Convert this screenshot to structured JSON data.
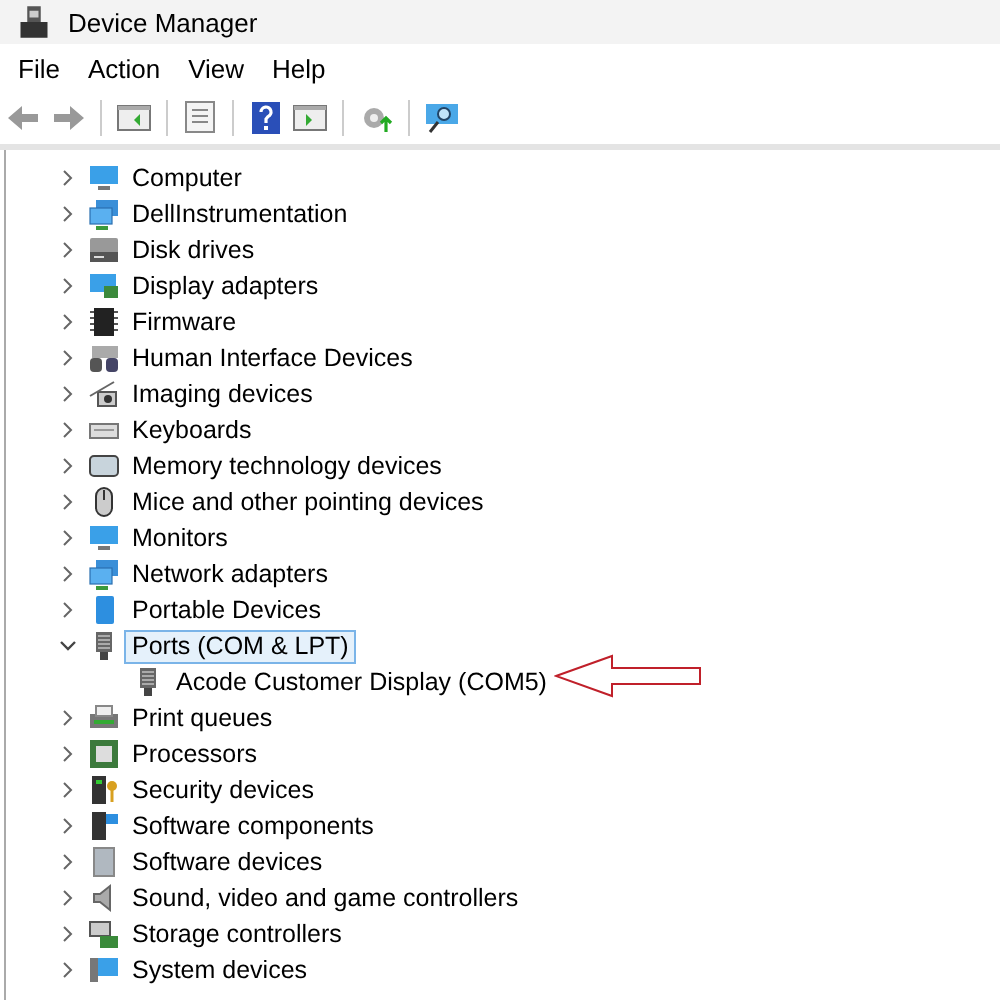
{
  "window": {
    "title": "Device Manager"
  },
  "menu": [
    "File",
    "Action",
    "View",
    "Help"
  ],
  "tree": [
    {
      "label": "Computer",
      "expanded": false,
      "selected": false
    },
    {
      "label": "DellInstrumentation",
      "expanded": false,
      "selected": false
    },
    {
      "label": "Disk drives",
      "expanded": false,
      "selected": false
    },
    {
      "label": "Display adapters",
      "expanded": false,
      "selected": false
    },
    {
      "label": "Firmware",
      "expanded": false,
      "selected": false
    },
    {
      "label": "Human Interface Devices",
      "expanded": false,
      "selected": false
    },
    {
      "label": "Imaging devices",
      "expanded": false,
      "selected": false
    },
    {
      "label": "Keyboards",
      "expanded": false,
      "selected": false
    },
    {
      "label": "Memory technology devices",
      "expanded": false,
      "selected": false
    },
    {
      "label": "Mice and other pointing devices",
      "expanded": false,
      "selected": false
    },
    {
      "label": "Monitors",
      "expanded": false,
      "selected": false
    },
    {
      "label": "Network adapters",
      "expanded": false,
      "selected": false
    },
    {
      "label": "Portable Devices",
      "expanded": false,
      "selected": false
    },
    {
      "label": "Ports (COM & LPT)",
      "expanded": true,
      "selected": true,
      "children": [
        {
          "label": "Acode Customer Display (COM5)",
          "selected": false
        }
      ]
    },
    {
      "label": "Print queues",
      "expanded": false,
      "selected": false
    },
    {
      "label": "Processors",
      "expanded": false,
      "selected": false
    },
    {
      "label": "Security devices",
      "expanded": false,
      "selected": false
    },
    {
      "label": "Software components",
      "expanded": false,
      "selected": false
    },
    {
      "label": "Software devices",
      "expanded": false,
      "selected": false
    },
    {
      "label": "Sound, video and game controllers",
      "expanded": false,
      "selected": false
    },
    {
      "label": "Storage controllers",
      "expanded": false,
      "selected": false
    },
    {
      "label": "System devices",
      "expanded": false,
      "selected": false
    }
  ]
}
